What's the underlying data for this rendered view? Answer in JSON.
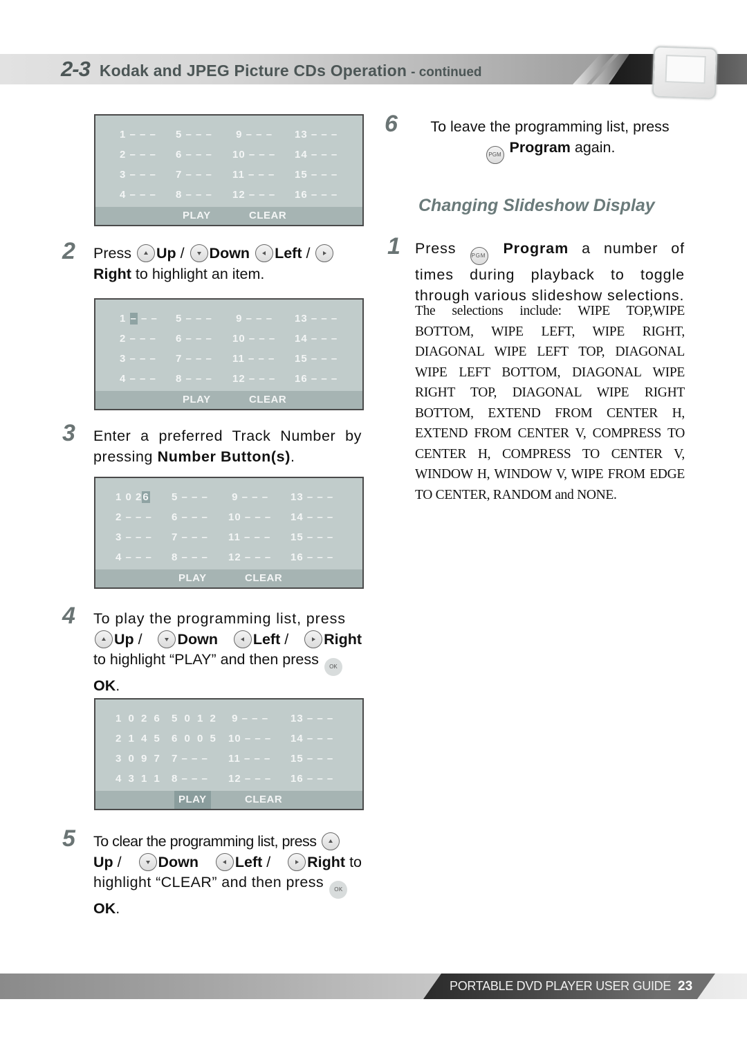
{
  "header": {
    "section_number": "2-3",
    "title": "Kodak and JPEG Picture CDs Operation",
    "suffix": "- continued",
    "device_icon": "portable-dvd-player-icon"
  },
  "osd_labels": {
    "play": "PLAY",
    "clear": "CLEAR"
  },
  "osd_panels": [
    {
      "rows": [
        [
          "1 – – –",
          "5 – – –",
          " 9 – – –",
          "13 – – –"
        ],
        [
          "2 – – –",
          "6 – – –",
          "10 – – –",
          "14 – – –"
        ],
        [
          "3 – – –",
          "7 – – –",
          "11 – – –",
          "15 – – –"
        ],
        [
          "4 – – –",
          "8 – – –",
          "12 – – –",
          "16 – – –"
        ]
      ],
      "highlight": "none"
    },
    {
      "rows": [
        [
          "1",
          "5 – – –",
          " 9 – – –",
          "13 – – –"
        ],
        [
          "2 – – –",
          "6 – – –",
          "10 – – –",
          "14 – – –"
        ],
        [
          "3 – – –",
          "7 – – –",
          "11 – – –",
          "15 – – –"
        ],
        [
          "4 – – –",
          "8 – – –",
          "12 – – –",
          "16 – – –"
        ]
      ],
      "cell1_highlighted": "–",
      "cell1_rest": " – –",
      "highlight": "slot-1-digit-1"
    },
    {
      "rows": [
        [
          "1 0 2",
          "5 – – –",
          " 9 – – –",
          "13 – – –"
        ],
        [
          "2 – – –",
          "6 – – –",
          "10 – – –",
          "14 – – –"
        ],
        [
          "3 – – –",
          "7 – – –",
          "11 – – –",
          "15 – – –"
        ],
        [
          "4 – – –",
          "8 – – –",
          "12 – – –",
          "16 – – –"
        ]
      ],
      "cell1_highlighted": "6",
      "highlight": "slot-1-digit-3"
    },
    {
      "rows": [
        [
          "1 0 2 6",
          "5 0 1 2",
          " 9 – – –",
          "13 – – –"
        ],
        [
          "2 1 4 5",
          "6 0 0 5",
          "10 – – –",
          "14 – – –"
        ],
        [
          "3 0 9 7",
          "7 – – –",
          "11 – – –",
          "15 – – –"
        ],
        [
          "4 3 1 1",
          "8 – – –",
          "12 – – –",
          "16 – – –"
        ]
      ],
      "highlight": "PLAY"
    }
  ],
  "steps": {
    "s2": {
      "num": "2",
      "press": "Press",
      "up": "Up",
      "slash": " / ",
      "down": "Down",
      "left": "Left",
      "right": "Right",
      "tail": " to highlight an item."
    },
    "s3": {
      "num": "3",
      "line1": "Enter a preferred Track Number by pressing ",
      "bold": "Number Button(s)",
      "end": "."
    },
    "s4": {
      "num": "4",
      "line1": "To play the programming list, press",
      "up": "Up",
      "down": "Down",
      "left": "Left",
      "right": "Right",
      "tail": "to highlight “PLAY” and then press",
      "ok": "OK",
      "end": "."
    },
    "s5": {
      "num": "5",
      "line1": "To clear the programming list, press",
      "up": "Up",
      "down": "Down",
      "left": "Left",
      "right": "Right",
      "to": " to",
      "tail": "highlight “CLEAR” and then press",
      "ok": "OK",
      "end": "."
    },
    "s6": {
      "num": "6",
      "line1": "To leave the programming list, press",
      "program": "Program",
      "tail": " again."
    }
  },
  "buttons": {
    "ok_label": "OK",
    "pgm_label": "PGM"
  },
  "slideshow": {
    "title": "Changing Slideshow Display",
    "step_num": "1",
    "press": "Press",
    "program": "Program",
    "tail": " a number of times during playback to toggle through various slideshow selections.",
    "selections_text": "The selections include: WIPE TOP,WIPE BOTTOM, WIPE LEFT, WIPE RIGHT, DIAGONAL WIPE LEFT TOP, DIAGONAL WIPE LEFT BOTTOM, DIAGONAL WIPE RIGHT TOP, DIAGONAL WIPE RIGHT BOTTOM, EXTEND FROM CENTER H, EXTEND FROM CENTER V, COMPRESS TO CENTER H, COMPRESS TO CENTER V, WINDOW H, WINDOW V, WIPE FROM EDGE TO CENTER, RANDOM and NONE."
  },
  "footer": {
    "guide_title": "PORTABLE DVD PLAYER USER GUIDE",
    "page_number": "23"
  }
}
